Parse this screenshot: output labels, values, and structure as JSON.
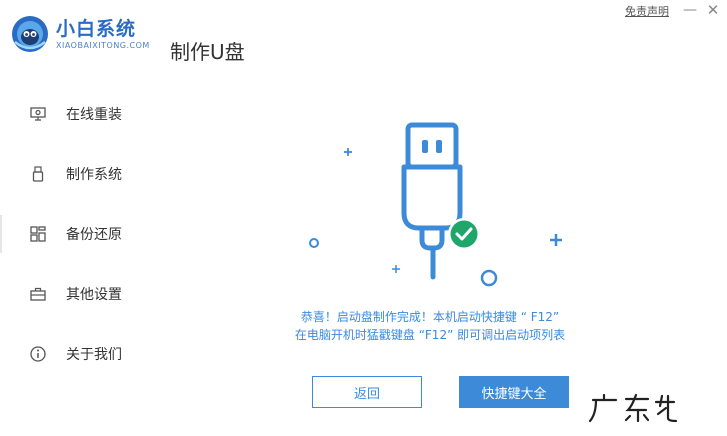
{
  "header": {
    "brand_name": "小白系统",
    "brand_sub": "XIAOBAIXITONG.COM",
    "page_title": "制作U盘",
    "disclaimer": "免责声明",
    "minimize_symbol": "—",
    "close_symbol": "✕"
  },
  "sidebar": {
    "items": [
      {
        "label": "在线重装",
        "icon": "monitor-icon"
      },
      {
        "label": "制作系统",
        "icon": "usb-icon"
      },
      {
        "label": "备份还原",
        "icon": "grid-icon",
        "active": true
      },
      {
        "label": "其他设置",
        "icon": "toolbox-icon"
      },
      {
        "label": "关于我们",
        "icon": "info-icon"
      }
    ]
  },
  "main": {
    "message_line1": "恭喜！启动盘制作完成！本机启动快捷键 “ F12”",
    "message_line2": "在电脑开机时猛戳键盘 “F12” 即可调出启动项列表",
    "back_label": "返回",
    "hotkeys_label": "快捷键大全"
  },
  "colors": {
    "accent": "#3d8bd8",
    "success": "#1fa76b",
    "text": "#333333"
  }
}
